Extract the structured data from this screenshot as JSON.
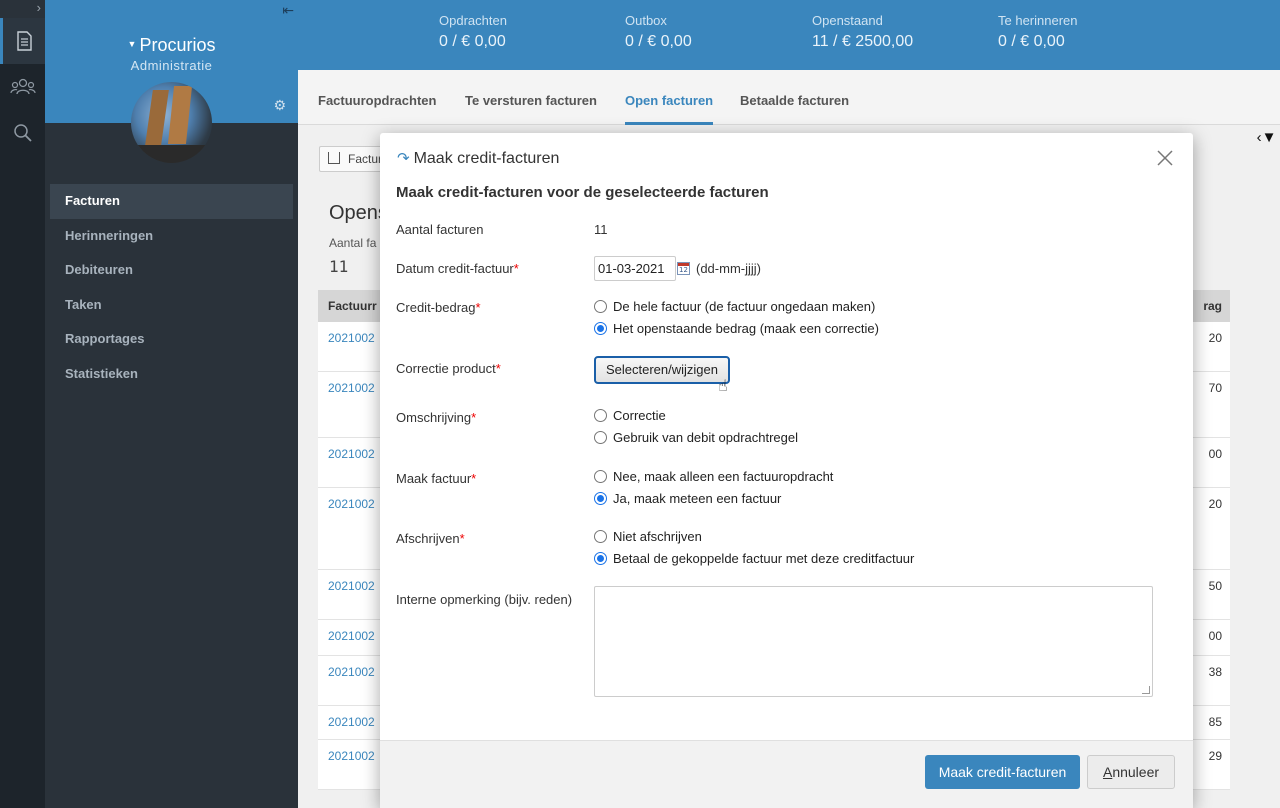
{
  "rail": {
    "expand_icon": "›",
    "items": [
      {
        "icon": "document-icon",
        "active": true
      },
      {
        "icon": "users-icon",
        "active": false
      },
      {
        "icon": "search-icon",
        "active": false
      }
    ]
  },
  "sidebar": {
    "company": "Procurios",
    "subtitle": "Administratie",
    "items": [
      {
        "label": "Facturen",
        "active": true
      },
      {
        "label": "Herinneringen",
        "active": false
      },
      {
        "label": "Debiteuren",
        "active": false
      },
      {
        "label": "Taken",
        "active": false
      },
      {
        "label": "Rapportages",
        "active": false
      },
      {
        "label": "Statistieken",
        "active": false
      }
    ]
  },
  "stats": [
    {
      "label": "Opdrachten",
      "value": "0 / € 0,00"
    },
    {
      "label": "Outbox",
      "value": "0 / € 0,00"
    },
    {
      "label": "Openstaand",
      "value": "11 / € 2500,00"
    },
    {
      "label": "Te herinneren",
      "value": "0 / € 0,00"
    }
  ],
  "tabs": [
    {
      "label": "Factuuropdrachten",
      "active": false
    },
    {
      "label": "Te versturen facturen",
      "active": false
    },
    {
      "label": "Open facturen",
      "active": true
    },
    {
      "label": "Betaalde facturen",
      "active": false
    }
  ],
  "background": {
    "export_button": "Factur",
    "title": "Opens",
    "count_label": "Aantal fa",
    "count": "11",
    "table_header_left": "Factuurr",
    "table_header_right": "rag",
    "rows": [
      {
        "id": "2021002",
        "amount": "20"
      },
      {
        "id": "2021002",
        "amount": "70"
      },
      {
        "id": "2021002",
        "amount": "00"
      },
      {
        "id": "2021002",
        "amount": "20"
      },
      {
        "id": "2021002",
        "amount": "50"
      },
      {
        "id": "2021002",
        "amount": "00"
      },
      {
        "id": "2021002",
        "amount": "38"
      },
      {
        "id": "2021002",
        "amount": "85"
      },
      {
        "id": "2021002",
        "amount": "29"
      }
    ]
  },
  "modal": {
    "title": "Maak credit-facturen",
    "subtitle": "Maak credit-facturen voor de geselecteerde facturen",
    "count_label": "Aantal facturen",
    "count_value": "11",
    "date_label": "Datum credit-factuur",
    "date_value": "01-03-2021",
    "calendar_day": "12",
    "date_hint": "(dd-mm-jjjj)",
    "amount_label": "Credit-bedrag",
    "amount_options": [
      {
        "label": "De hele factuur (de factuur ongedaan maken)",
        "checked": false
      },
      {
        "label": "Het openstaande bedrag (maak een correctie)",
        "checked": true
      }
    ],
    "product_label": "Correctie product",
    "product_button": "Selecteren/wijzigen",
    "description_label": "Omschrijving",
    "description_options": [
      {
        "label": "Correctie",
        "checked": false
      },
      {
        "label": "Gebruik van debit opdrachtregel",
        "checked": false
      }
    ],
    "invoice_label": "Maak factuur",
    "invoice_options": [
      {
        "label": "Nee, maak alleen een factuuropdracht",
        "checked": false
      },
      {
        "label": "Ja, maak meteen een factuur",
        "checked": true
      }
    ],
    "writeoff_label": "Afschrijven",
    "writeoff_options": [
      {
        "label": "Niet afschrijven",
        "checked": false
      },
      {
        "label": "Betaal de gekoppelde factuur met deze creditfactuur",
        "checked": true
      }
    ],
    "note_label": "Interne opmerking (bijv. reden)",
    "note_value": "",
    "submit_button": "Maak credit-facturen",
    "cancel_first_letter": "A",
    "cancel_rest": "nnuleer",
    "required_mark": "*"
  },
  "colors": {
    "brand": "#3a86bd",
    "required": "#e00000"
  }
}
